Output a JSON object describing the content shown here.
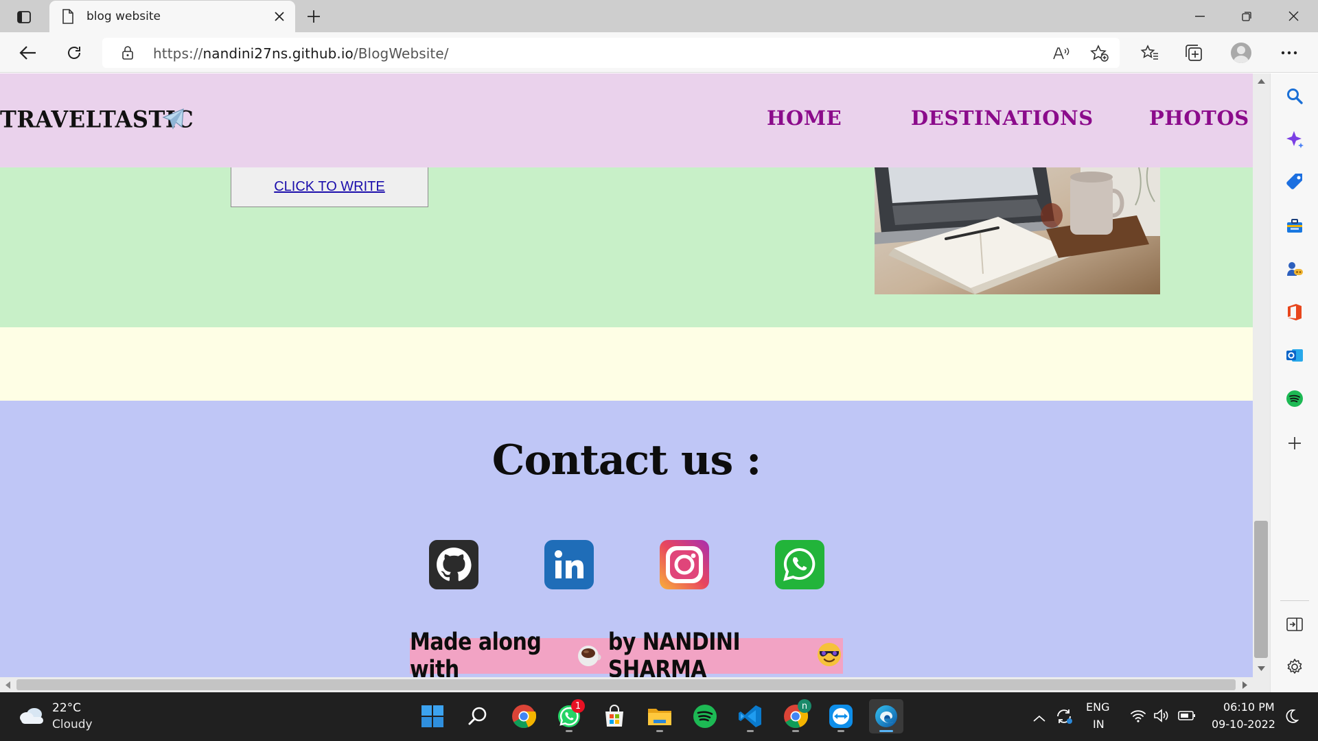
{
  "browser": {
    "tab_title": "blog website",
    "url_prefix": "https://",
    "url_host": "nandini27ns.github.io",
    "url_path": "/BlogWebsite/"
  },
  "site": {
    "brand": "TRAVELTASTIC",
    "nav": [
      "HOME",
      "DESTINATIONS",
      "PHOTOS"
    ],
    "write_link": "CLICK TO WRITE",
    "contact_title": "Contact us :",
    "social": [
      "github-icon",
      "linkedin-icon",
      "instagram-icon",
      "whatsapp-icon"
    ],
    "made_along_with": "Made along with",
    "made_by": "by NANDINI SHARMA"
  },
  "taskbar": {
    "temperature": "22°C",
    "weather": "Cloudy",
    "language": "ENG",
    "region": "IN",
    "time": "06:10 PM",
    "date": "09-10-2022",
    "whatsapp_badge": "1",
    "chrome_profile_badge": "n"
  },
  "colors": {
    "header_bg": "#ead2ec",
    "nav_link": "#8b0b8b",
    "green_section": "#c8f0c8",
    "cream_section": "#fefee5",
    "contact_bg": "#bfc6f6",
    "made_banner": "#f2a3c4"
  }
}
